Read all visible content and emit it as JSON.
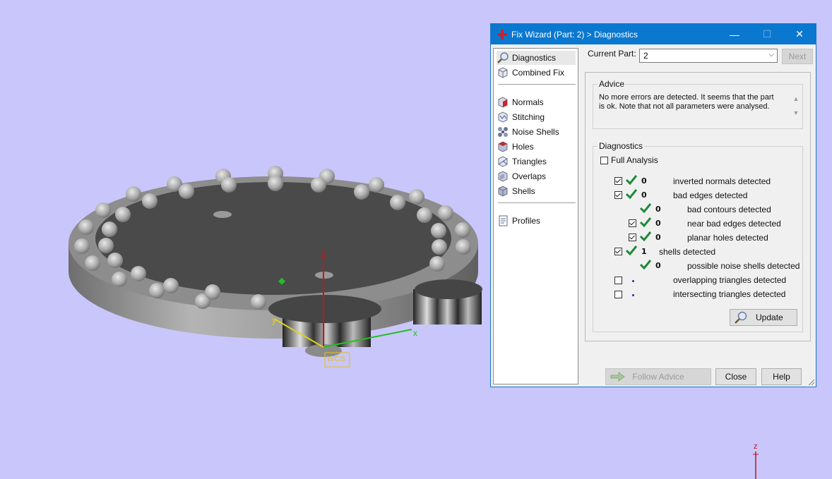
{
  "dialog": {
    "title": "Fix Wizard (Part: 2) > Diagnostics",
    "window_buttons": {
      "minimize": "—",
      "maximize": "☐",
      "close": "✕"
    }
  },
  "nav": {
    "items": [
      {
        "label": "Diagnostics",
        "icon": "magnifier-icon"
      },
      {
        "label": "Combined Fix",
        "icon": "cube-icon"
      },
      {
        "label": "Normals",
        "icon": "normals-cube-icon"
      },
      {
        "label": "Stitching",
        "icon": "stitching-cube-icon"
      },
      {
        "label": "Noise Shells",
        "icon": "noise-shells-icon"
      },
      {
        "label": "Holes",
        "icon": "holes-cube-icon"
      },
      {
        "label": "Triangles",
        "icon": "triangles-cube-icon"
      },
      {
        "label": "Overlaps",
        "icon": "overlaps-cube-icon"
      },
      {
        "label": "Shells",
        "icon": "shells-cube-icon"
      },
      {
        "label": "Profiles",
        "icon": "document-icon"
      }
    ]
  },
  "current_part": {
    "label": "Current Part:",
    "value": "2",
    "next_label": "Next"
  },
  "advice": {
    "title": "Advice",
    "text": "No more errors are detected. It seems that the part is ok. Note that not all parameters were analysed."
  },
  "diagnostics": {
    "title": "Diagnostics",
    "full_analysis_label": "Full Analysis",
    "rows": [
      {
        "checkbox": true,
        "checked": true,
        "status": "ok",
        "count": "0",
        "label": "inverted normals detected"
      },
      {
        "checkbox": true,
        "checked": true,
        "status": "ok",
        "count": "0",
        "label": "bad edges detected"
      },
      {
        "checkbox": false,
        "checked": false,
        "status": "ok",
        "count": "0",
        "label": "bad contours detected"
      },
      {
        "checkbox": true,
        "checked": true,
        "status": "ok",
        "count": "0",
        "label": "near bad edges detected"
      },
      {
        "checkbox": true,
        "checked": true,
        "status": "ok",
        "count": "0",
        "label": "planar holes detected"
      },
      {
        "checkbox": true,
        "checked": true,
        "status": "ok",
        "count": "1",
        "label": "shells detected"
      },
      {
        "checkbox": false,
        "checked": false,
        "status": "ok",
        "count": "0",
        "label": "possible noise shells detected"
      },
      {
        "checkbox": true,
        "checked": false,
        "status": "unknown",
        "count": "",
        "label": "overlapping triangles detected"
      },
      {
        "checkbox": true,
        "checked": false,
        "status": "unknown",
        "count": "",
        "label": "intersecting triangles detected"
      }
    ],
    "update_label": "Update"
  },
  "footer": {
    "follow_advice": "Follow Advice",
    "close": "Close",
    "help": "Help"
  },
  "viewport": {
    "axis_x": "x",
    "axis_y": "y",
    "axis_z": "z",
    "wcs_label": "WCS",
    "corner_axis_z": "z",
    "background": "#c9c6fb",
    "part_color": "#8f8f8f",
    "accent": "#0b78d0"
  }
}
